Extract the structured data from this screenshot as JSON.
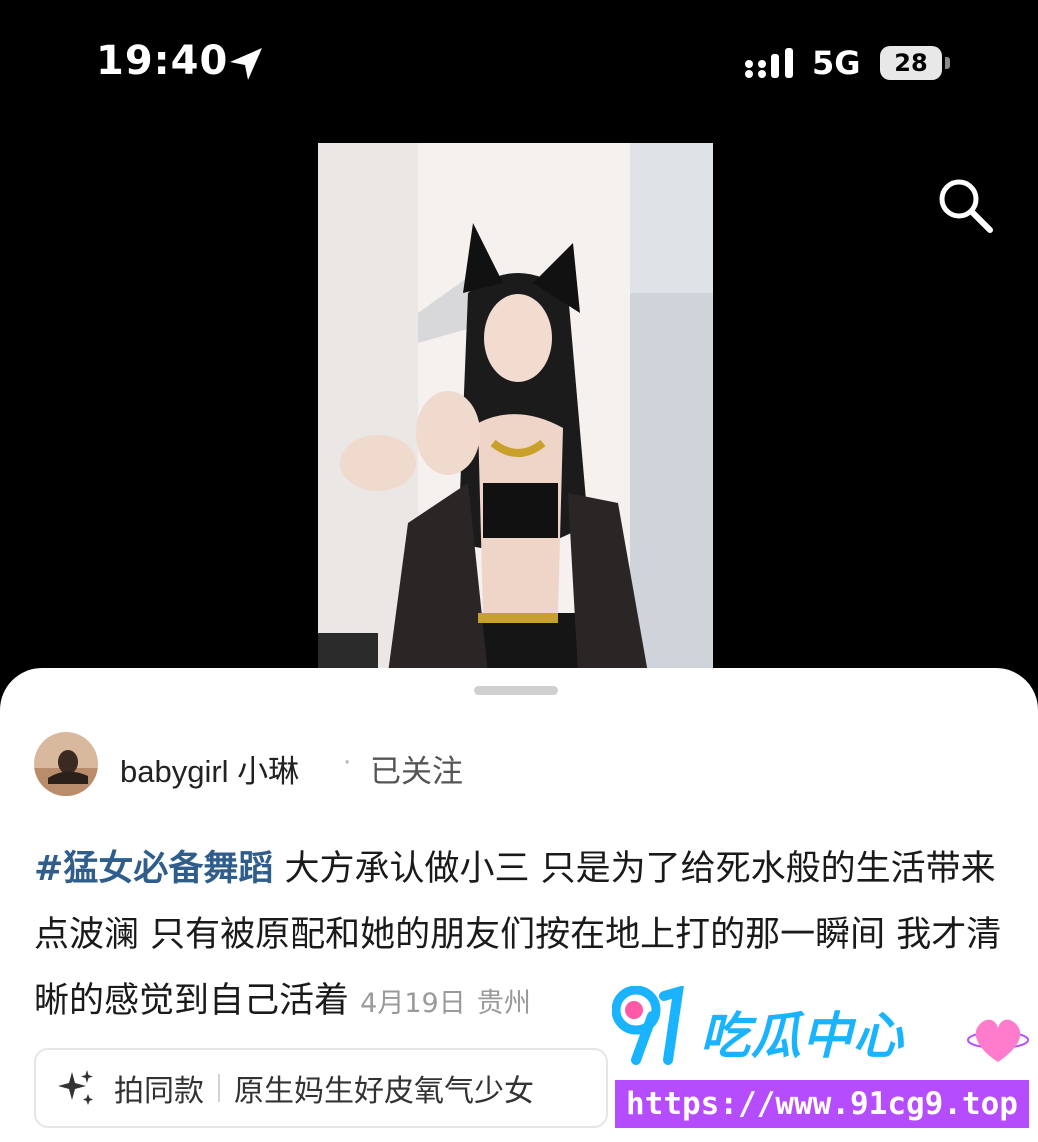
{
  "status_bar": {
    "time": "19:40",
    "network": "5G",
    "battery": "28"
  },
  "post": {
    "username": "babygirl 小琳",
    "separator": "·",
    "follow_status": "已关注",
    "hashtag": "#猛女必备舞蹈",
    "caption": " 大方承认做小三 只是为了给死水般的生活带来点波澜 只有被原配和她的朋友们按在地上打的那一瞬间 我才清晰的感觉到自己活着",
    "date": "4月19日",
    "location": "贵州"
  },
  "chip": {
    "label": "拍同款",
    "tag": "原生妈生好皮氧气少女"
  },
  "watermark": {
    "title": "吃瓜中心",
    "url": "https://www.91cg9.top"
  },
  "colors": {
    "hashtag": "#2f5d8c",
    "watermark_text": "#1ab3ff",
    "watermark_band": "#b54dff"
  }
}
